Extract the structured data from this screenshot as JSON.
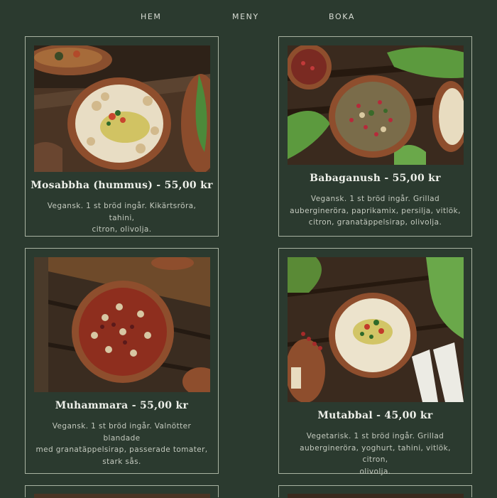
{
  "nav": {
    "items": [
      "HEM",
      "MENY",
      "BOKA"
    ]
  },
  "dishes": [
    {
      "title": "Mosabbha (hummus) - 55,00 kr",
      "desc_lines": [
        "Vegansk. 1 st bröd ingår. Kikärtsröra, tahini,",
        "citron, olivolja."
      ],
      "image": "hummus-bowl-photo"
    },
    {
      "title": "Babaganush - 55,00 kr",
      "desc_lines": [
        "Vegansk. 1 st bröd ingår. Grillad",
        "auberginеröra, paprikamix, persilja, vitlök,",
        "citron, granatäppelsirap, olivolja."
      ],
      "image": "babaganush-bowl-photo"
    },
    {
      "title": "Muhammara - 55,00 kr",
      "desc_lines": [
        "Vegansk. 1 st bröd ingår. Valnötter blandade",
        "med granatäppelsirap, passerade tomater,",
        "stark sås."
      ],
      "image": "muhammara-bowl-photo"
    },
    {
      "title": "Mutabbal - 45,00 kr",
      "desc_lines": [
        "Vegetarisk. 1 st bröd ingår. Grillad",
        "auberginеröra, yoghurt, tahini, vitlök, citron,",
        "olivolja."
      ],
      "image": "mutabbal-bowl-photo"
    }
  ]
}
